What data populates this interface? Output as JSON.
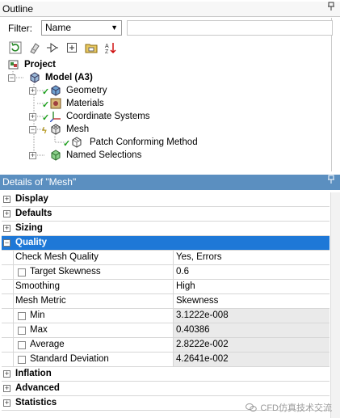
{
  "outline": {
    "title": "Outline",
    "pin": "ꟼ",
    "filter_label": "Filter:",
    "filter_value": "Name",
    "filter_text": ""
  },
  "toolbar": {
    "icons": [
      "refresh-icon",
      "collapse-icon",
      "generate-icon",
      "expand-all-icon",
      "folder-icon",
      "sort-icon"
    ]
  },
  "tree": {
    "project": "Project",
    "model": "Model (A3)",
    "geometry": "Geometry",
    "materials": "Materials",
    "coordinate_systems": "Coordinate Systems",
    "mesh": "Mesh",
    "patch_method": "Patch Conforming Method",
    "named_selections": "Named Selections"
  },
  "details": {
    "title": "Details of \"Mesh\"",
    "pin": "ꟼ",
    "groups": {
      "display": "Display",
      "defaults": "Defaults",
      "sizing": "Sizing",
      "quality": "Quality",
      "inflation": "Inflation",
      "advanced": "Advanced",
      "statistics": "Statistics"
    },
    "rows": [
      {
        "label": "Check Mesh Quality",
        "value": "Yes, Errors"
      },
      {
        "label": "Target Skewness",
        "value": "0.6"
      },
      {
        "label": "Smoothing",
        "value": "High"
      },
      {
        "label": "Mesh Metric",
        "value": "Skewness"
      },
      {
        "label": "Min",
        "value": "3.1222e-008"
      },
      {
        "label": "Max",
        "value": "0.40386"
      },
      {
        "label": "Average",
        "value": "2.8222e-002"
      },
      {
        "label": "Standard Deviation",
        "value": "4.2641e-002"
      }
    ]
  },
  "watermark": "CFD仿真技术交流",
  "colors": {
    "header_blue": "#5b8fc0",
    "selected_blue": "#1e78d7",
    "check_green": "#1a9e1a"
  }
}
